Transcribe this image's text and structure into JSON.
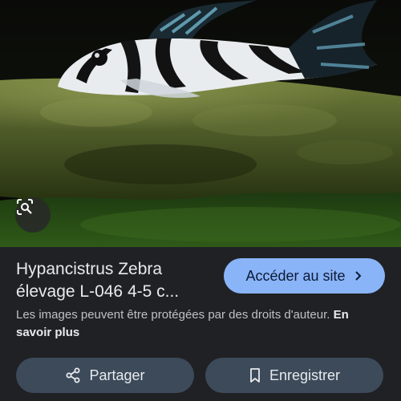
{
  "result": {
    "title_line1": "Hypancistrus Zebra",
    "title_line2": "élevage L-046 4-5 c..."
  },
  "visit": {
    "label": "Accéder au site",
    "icon": "chevron-right-icon"
  },
  "notice": {
    "text": "Les images peuvent être protégées par des droits d'auteur. ",
    "link": "En savoir plus"
  },
  "actions": {
    "share_label": "Partager",
    "share_icon": "share-icon",
    "save_label": "Enregistrer",
    "save_icon": "bookmark-icon"
  },
  "lens": {
    "icon": "lens-search-icon"
  },
  "colors": {
    "background": "#202124",
    "accent": "#8ab4f8",
    "button_bg": "#3c4a5a",
    "text_primary": "#e8eaed",
    "text_secondary": "#bdc1c6"
  }
}
